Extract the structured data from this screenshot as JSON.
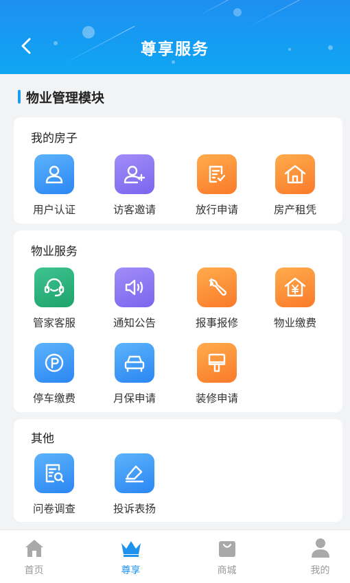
{
  "header": {
    "title": "尊享服务"
  },
  "section": {
    "title": "物业管理模块"
  },
  "cards": [
    {
      "title": "我的房子",
      "items": [
        {
          "label": "用户认证",
          "icon": "user-icon",
          "color": "blue"
        },
        {
          "label": "访客邀请",
          "icon": "user-add-icon",
          "color": "purple"
        },
        {
          "label": "放行申请",
          "icon": "document-check-icon",
          "color": "orange"
        },
        {
          "label": "房产租凭",
          "icon": "house-icon",
          "color": "orange"
        }
      ]
    },
    {
      "title": "物业服务",
      "items": [
        {
          "label": "管家客服",
          "icon": "headset-icon",
          "color": "green"
        },
        {
          "label": "通知公告",
          "icon": "speaker-icon",
          "color": "purple"
        },
        {
          "label": "报事报修",
          "icon": "wrench-icon",
          "color": "orange"
        },
        {
          "label": "物业缴费",
          "icon": "house-yen-icon",
          "color": "orange"
        },
        {
          "label": "停车缴费",
          "icon": "parking-icon",
          "color": "blue"
        },
        {
          "label": "月保申请",
          "icon": "car-icon",
          "color": "blue"
        },
        {
          "label": "装修申请",
          "icon": "paint-brush-icon",
          "color": "orange"
        }
      ]
    },
    {
      "title": "其他",
      "items": [
        {
          "label": "问卷调查",
          "icon": "survey-search-icon",
          "color": "blue"
        },
        {
          "label": "投诉表扬",
          "icon": "feedback-pen-icon",
          "color": "blue"
        }
      ]
    }
  ],
  "tabbar": {
    "items": [
      {
        "label": "首页",
        "icon": "home-icon",
        "active": false
      },
      {
        "label": "尊享",
        "icon": "crown-icon",
        "active": true
      },
      {
        "label": "商城",
        "icon": "shopping-bag-icon",
        "active": false
      },
      {
        "label": "我的",
        "icon": "person-icon",
        "active": false
      }
    ]
  },
  "colors": {
    "header_gradient_start": "#1f8ff0",
    "header_gradient_end": "#0fa6f3",
    "accent": "#1e93ee",
    "tab_inactive": "#9a9a9a",
    "background": "#f2f3f5"
  }
}
